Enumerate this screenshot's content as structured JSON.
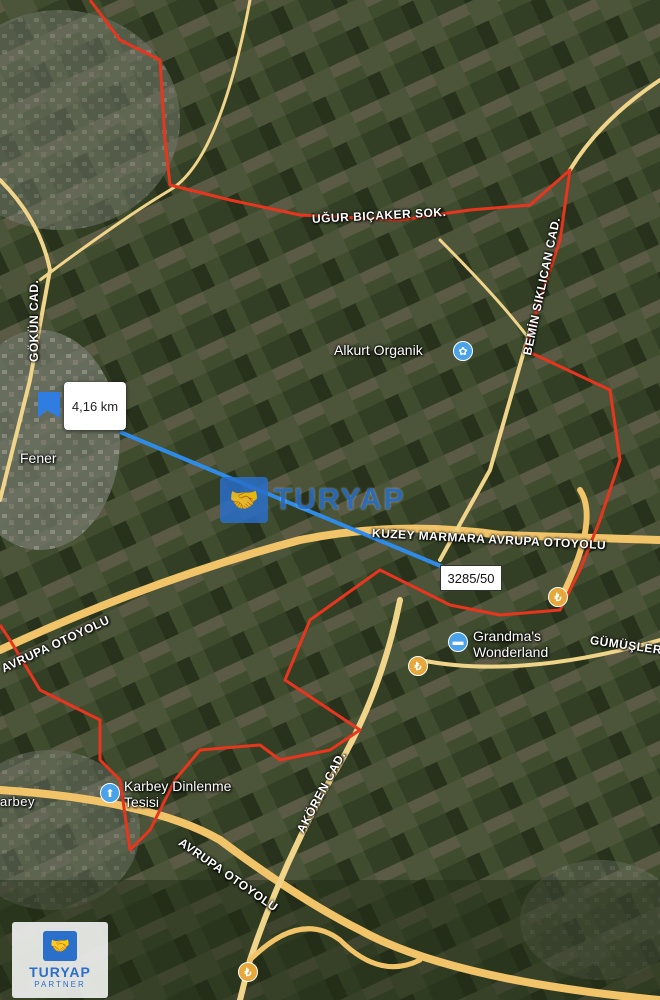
{
  "map": {
    "roads": {
      "ugur_bicaker": "UĞUR BIÇAKER SOK.",
      "gokun": "GÖKÜN CAD.",
      "bemin": "BEMİN SIKLICAN CAD.",
      "kuzey_marmara": "KUZEY MARMARA AVRUPA OTOYOLU",
      "avrupa_otoyolu_left": "AVRUPA OTOYOLU",
      "avrupa_otoyolu_bottom": "AVRUPA OTOYOLU",
      "gumusler": "GÜMÜŞLER",
      "akoren": "AKÖREN CAD.",
      "karbey_road": "arbey"
    },
    "places": {
      "fener": "Fener",
      "alkurt": "Alkurt Organik",
      "grandma_line1": "Grandma's",
      "grandma_line2": "Wonderland",
      "karbey_line1": "Karbey Dinlenme",
      "karbey_line2": "Tesisi"
    },
    "distance_label": "4,16 km",
    "parcel_label": "3285/50",
    "watermark": {
      "center_text": "TURYAP",
      "brand": "TURYAP",
      "sub": "PARTNER"
    },
    "colors": {
      "boundary": "#e8351e",
      "distance_line": "#2f8be8",
      "highway": "#f2c46a",
      "road": "#f0d48a",
      "watermark": "#2a6fc9"
    },
    "icons": {
      "alkurt": "tulip-icon",
      "grandma": "hotel-icon",
      "karbey": "rest-stop-icon",
      "lira": "lira-icon"
    }
  }
}
